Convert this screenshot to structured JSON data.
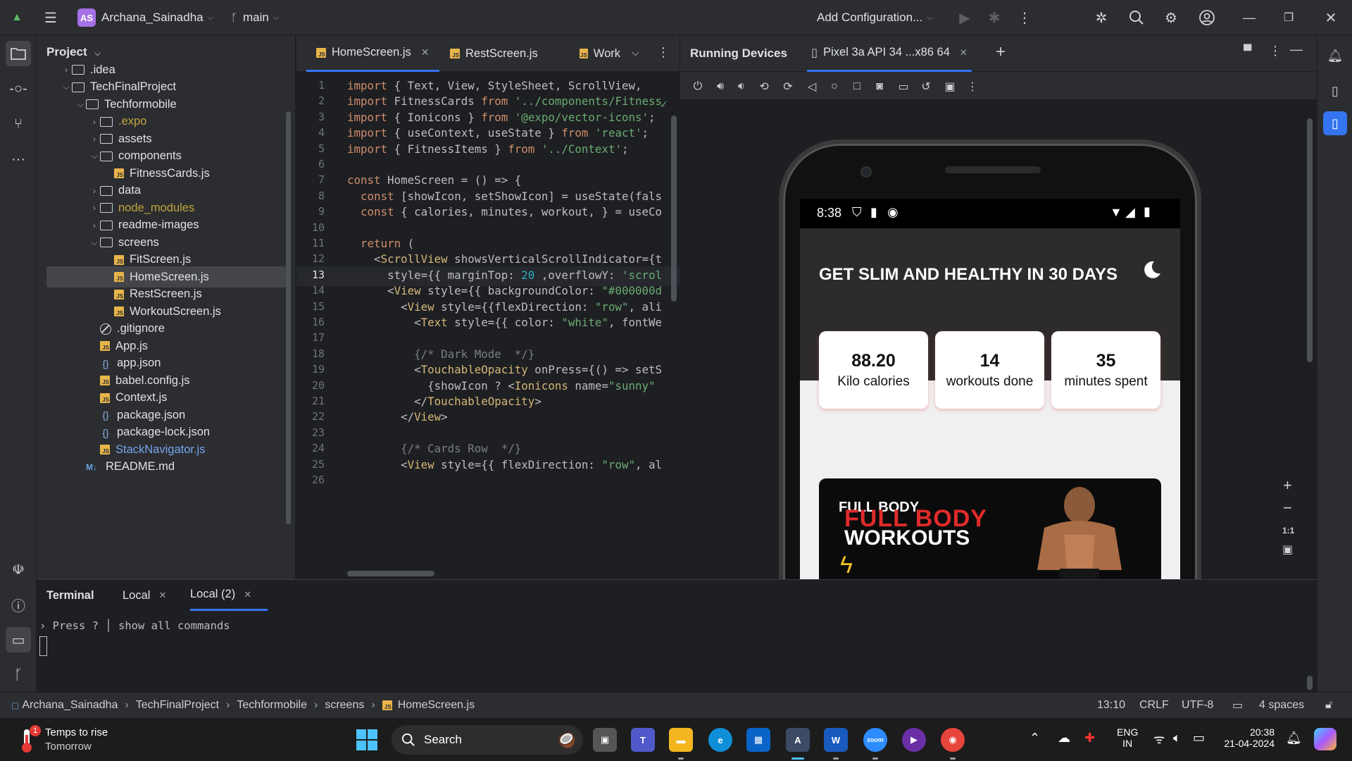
{
  "titlebar": {
    "avatar_initials": "AS",
    "project_name": "Archana_Sainadha",
    "branch": "main",
    "run_config": "Add Configuration..."
  },
  "project_panel": {
    "header": "Project",
    "tree": [
      {
        "label": ".idea",
        "type": "folder",
        "depth": 1,
        "expanded": false
      },
      {
        "label": "TechFinalProject",
        "type": "folder",
        "depth": 1,
        "expanded": true
      },
      {
        "label": "Techformobile",
        "type": "folder",
        "depth": 2,
        "expanded": true
      },
      {
        "label": ".expo",
        "type": "folder",
        "depth": 3,
        "expanded": false,
        "color": "yellow"
      },
      {
        "label": "assets",
        "type": "folder",
        "depth": 3,
        "expanded": false
      },
      {
        "label": "components",
        "type": "folder",
        "depth": 3,
        "expanded": true
      },
      {
        "label": "FitnessCards.js",
        "type": "js",
        "depth": 4
      },
      {
        "label": "data",
        "type": "folder",
        "depth": 3,
        "expanded": false
      },
      {
        "label": "node_modules",
        "type": "folder",
        "depth": 3,
        "expanded": false,
        "color": "yellow"
      },
      {
        "label": "readme-images",
        "type": "folder",
        "depth": 3,
        "expanded": false
      },
      {
        "label": "screens",
        "type": "folder",
        "depth": 3,
        "expanded": true
      },
      {
        "label": "FitScreen.js",
        "type": "js",
        "depth": 4
      },
      {
        "label": "HomeScreen.js",
        "type": "js",
        "depth": 4,
        "selected": true
      },
      {
        "label": "RestScreen.js",
        "type": "js",
        "depth": 4
      },
      {
        "label": "WorkoutScreen.js",
        "type": "js",
        "depth": 4
      },
      {
        "label": ".gitignore",
        "type": "ignore",
        "depth": 3
      },
      {
        "label": "App.js",
        "type": "js",
        "depth": 3
      },
      {
        "label": "app.json",
        "type": "json",
        "depth": 3
      },
      {
        "label": "babel.config.js",
        "type": "js",
        "depth": 3
      },
      {
        "label": "Context.js",
        "type": "js",
        "depth": 3
      },
      {
        "label": "package.json",
        "type": "json",
        "depth": 3
      },
      {
        "label": "package-lock.json",
        "type": "json",
        "depth": 3
      },
      {
        "label": "StackNavigator.js",
        "type": "js",
        "depth": 3,
        "color": "blue"
      },
      {
        "label": "README.md",
        "type": "md",
        "depth": 2
      }
    ]
  },
  "editor": {
    "tabs": [
      {
        "label": "HomeScreen.js",
        "active": true,
        "closable": true
      },
      {
        "label": "RestScreen.js",
        "active": false,
        "closable": false
      },
      {
        "label": "Work",
        "active": false,
        "closable": false
      }
    ],
    "current_line": 13,
    "lines": [
      "import { Text, View, StyleSheet, ScrollView,",
      "import FitnessCards from '../components/Fitness",
      "import { Ionicons } from '@expo/vector-icons';",
      "import { useContext, useState } from 'react';",
      "import { FitnessItems } from '../Context';",
      "",
      "const HomeScreen = () => {",
      "  const [showIcon, setShowIcon] = useState(fals",
      "  const { calories, minutes, workout, } = useCo",
      "",
      "  return (",
      "    <ScrollView showsVerticalScrollIndicator={t",
      "      style={{ marginTop: 20 ,overflowY: 'scrol",
      "      <View style={{ backgroundColor: \"#000000d",
      "        <View style={{flexDirection: \"row\", ali",
      "          <Text style={{ color: \"white\", fontWe",
      "",
      "          {/* Dark Mode  */}",
      "          <TouchableOpacity onPress={() => setS",
      "            {showIcon ? <Ionicons name=\"sunny\"",
      "          </TouchableOpacity>",
      "        </View>",
      "",
      "        {/* Cards Row  */}",
      "        <View style={{ flexDirection: \"row\", al",
      ""
    ]
  },
  "devices": {
    "panel_title": "Running Devices",
    "device_tab": "Pixel 3a API 34 ...x86 64",
    "zoom_label": "1:1"
  },
  "phone": {
    "time": "8:38",
    "app_title": "GET SLIM AND HEALTHY IN 30 DAYS",
    "stats": [
      {
        "value": "88.20",
        "label": "Kilo calories"
      },
      {
        "value": "14",
        "label": "workouts done"
      },
      {
        "value": "35",
        "label": "minutes spent"
      }
    ],
    "banner_small": "FULL BODY",
    "banner_red": "FULL BODY",
    "banner_white": "WORKOUTS"
  },
  "terminal": {
    "title": "Terminal",
    "tabs": [
      {
        "label": "Local",
        "active": false
      },
      {
        "label": "Local (2)",
        "active": true
      }
    ],
    "prompt_hint": "Press ? │ show all commands"
  },
  "status": {
    "breadcrumb": [
      "Archana_Sainadha",
      "TechFinalProject",
      "Techformobile",
      "screens",
      "HomeScreen.js"
    ],
    "position": "13:10",
    "line_ending": "CRLF",
    "encoding": "UTF-8",
    "indent": "4 spaces"
  },
  "taskbar": {
    "weather_title": "Temps to rise",
    "weather_sub": "Tomorrow",
    "search": "Search",
    "lang_1": "ENG",
    "lang_2": "IN",
    "time": "20:38",
    "date": "21-04-2024"
  },
  "colors": {
    "accent": "#3574f0",
    "ide_bg": "#1e1f22",
    "panel_bg": "#2b2d30",
    "app_dark": "#2d2b2b"
  }
}
